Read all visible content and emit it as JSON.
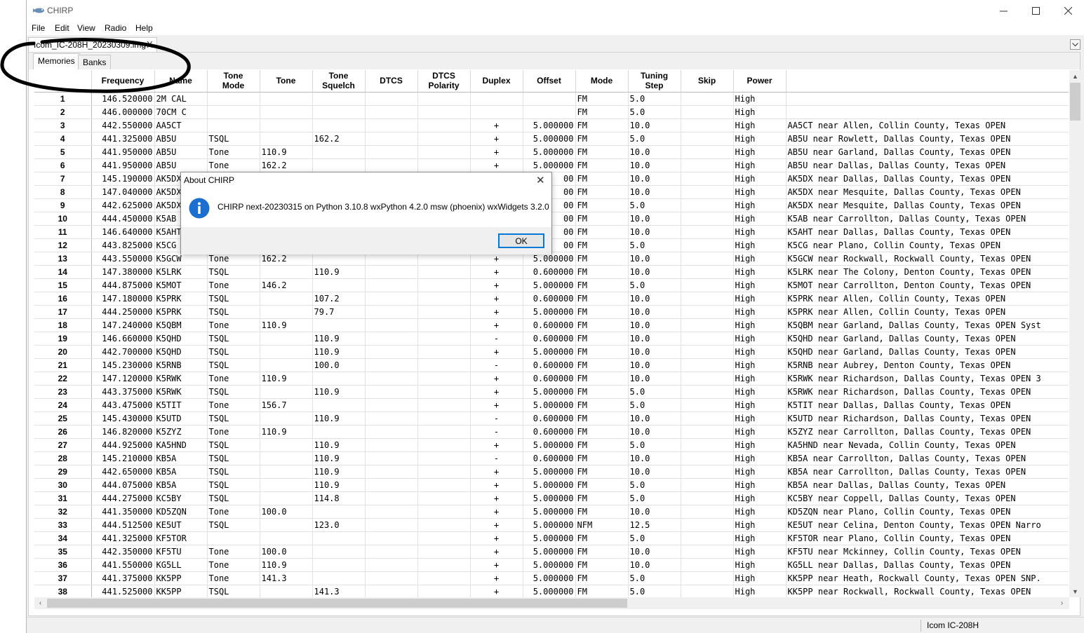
{
  "window": {
    "title": "CHIRP"
  },
  "menu": [
    "File",
    "Edit",
    "View",
    "Radio",
    "Help"
  ],
  "file_tab": {
    "label": "Icom_IC-208H_20230309.img",
    "close_glyph": "X"
  },
  "subtabs": [
    "Memories",
    "Banks"
  ],
  "columns": [
    "",
    "Frequency",
    "Name",
    "Tone\nMode",
    "Tone",
    "Tone\nSquelch",
    "DTCS",
    "DTCS\nPolarity",
    "Duplex",
    "Offset",
    "Mode",
    "Tuning\nStep",
    "Skip",
    "Power",
    ""
  ],
  "rows": [
    [
      "1",
      "146.520000",
      "2M CAL",
      "",
      "",
      "",
      "",
      "",
      "",
      "",
      "FM",
      "5.0",
      "",
      "High",
      ""
    ],
    [
      "2",
      "446.000000",
      "70CM C",
      "",
      "",
      "",
      "",
      "",
      "",
      "",
      "FM",
      "5.0",
      "",
      "High",
      ""
    ],
    [
      "3",
      "442.550000",
      "AA5CT",
      "",
      "",
      "",
      "",
      "",
      "+",
      "5.000000",
      "FM",
      "10.0",
      "",
      "High",
      "AA5CT near Allen, Collin County, Texas OPEN"
    ],
    [
      "4",
      "441.325000",
      "AB5U",
      "TSQL",
      "",
      "162.2",
      "",
      "",
      "+",
      "5.000000",
      "FM",
      "5.0",
      "",
      "High",
      "AB5U near Rowlett, Dallas County, Texas OPEN"
    ],
    [
      "5",
      "441.950000",
      "AB5U",
      "Tone",
      "110.9",
      "",
      "",
      "",
      "+",
      "5.000000",
      "FM",
      "10.0",
      "",
      "High",
      "AB5U near Garland, Dallas County, Texas OPEN"
    ],
    [
      "6",
      "441.950000",
      "AB5U",
      "Tone",
      "162.2",
      "",
      "",
      "",
      "+",
      "5.000000",
      "FM",
      "10.0",
      "",
      "High",
      "AB5U near Dallas, Dallas County, Texas OPEN"
    ],
    [
      "7",
      "145.190000",
      "AK5DX",
      "",
      "",
      "",
      "",
      "",
      "",
      "00",
      "FM",
      "10.0",
      "",
      "High",
      "AK5DX near Dallas, Dallas County, Texas OPEN"
    ],
    [
      "8",
      "147.040000",
      "AK5DX",
      "",
      "",
      "",
      "",
      "",
      "",
      "00",
      "FM",
      "10.0",
      "",
      "High",
      "AK5DX near Mesquite, Dallas County, Texas OPEN"
    ],
    [
      "9",
      "442.625000",
      "AK5DX",
      "",
      "",
      "",
      "",
      "",
      "",
      "00",
      "FM",
      "5.0",
      "",
      "High",
      "AK5DX near Mesquite, Dallas County, Texas OPEN"
    ],
    [
      "10",
      "444.450000",
      "K5AB",
      "",
      "",
      "",
      "",
      "",
      "",
      "00",
      "FM",
      "10.0",
      "",
      "High",
      "K5AB near Carrollton, Dallas County, Texas OPEN"
    ],
    [
      "11",
      "146.640000",
      "K5AHT",
      "",
      "",
      "",
      "",
      "",
      "",
      "00",
      "FM",
      "10.0",
      "",
      "High",
      "K5AHT near Dallas, Dallas County, Texas OPEN"
    ],
    [
      "12",
      "443.825000",
      "K5CG",
      "",
      "",
      "",
      "",
      "",
      "",
      "00",
      "FM",
      "5.0",
      "",
      "High",
      "K5CG near Plano, Collin County, Texas OPEN"
    ],
    [
      "13",
      "443.550000",
      "K5GCW",
      "Tone",
      "162.2",
      "",
      "",
      "",
      "+",
      "5.000000",
      "FM",
      "10.0",
      "",
      "High",
      "K5GCW near Rockwall, Rockwall County, Texas OPEN"
    ],
    [
      "14",
      "147.380000",
      "K5LRK",
      "TSQL",
      "",
      "110.9",
      "",
      "",
      "+",
      "0.600000",
      "FM",
      "10.0",
      "",
      "High",
      "K5LRK near The Colony, Denton County, Texas OPEN"
    ],
    [
      "15",
      "444.875000",
      "K5MOT",
      "Tone",
      "146.2",
      "",
      "",
      "",
      "+",
      "5.000000",
      "FM",
      "5.0",
      "",
      "High",
      "K5MOT near Carrollton, Denton County, Texas OPEN"
    ],
    [
      "16",
      "147.180000",
      "K5PRK",
      "TSQL",
      "",
      "107.2",
      "",
      "",
      "+",
      "0.600000",
      "FM",
      "10.0",
      "",
      "High",
      "K5PRK near Allen, Collin County, Texas OPEN"
    ],
    [
      "17",
      "444.250000",
      "K5PRK",
      "TSQL",
      "",
      "79.7",
      "",
      "",
      "+",
      "5.000000",
      "FM",
      "10.0",
      "",
      "High",
      "K5PRK near Allen, Collin County, Texas OPEN"
    ],
    [
      "18",
      "147.240000",
      "K5QBM",
      "Tone",
      "110.9",
      "",
      "",
      "",
      "+",
      "0.600000",
      "FM",
      "10.0",
      "",
      "High",
      "K5QBM near Garland, Dallas County, Texas OPEN Syst"
    ],
    [
      "19",
      "146.660000",
      "K5QHD",
      "TSQL",
      "",
      "110.9",
      "",
      "",
      "-",
      "0.600000",
      "FM",
      "10.0",
      "",
      "High",
      "K5QHD near Garland, Dallas County, Texas OPEN"
    ],
    [
      "20",
      "442.700000",
      "K5QHD",
      "TSQL",
      "",
      "110.9",
      "",
      "",
      "+",
      "5.000000",
      "FM",
      "10.0",
      "",
      "High",
      "K5QHD near Garland, Dallas County, Texas OPEN"
    ],
    [
      "21",
      "145.230000",
      "K5RNB",
      "TSQL",
      "",
      "100.0",
      "",
      "",
      "-",
      "0.600000",
      "FM",
      "10.0",
      "",
      "High",
      "K5RNB near Aubrey, Denton County, Texas OPEN"
    ],
    [
      "22",
      "147.120000",
      "K5RWK",
      "Tone",
      "110.9",
      "",
      "",
      "",
      "+",
      "0.600000",
      "FM",
      "10.0",
      "",
      "High",
      "K5RWK near Richardson, Dallas County, Texas OPEN 3"
    ],
    [
      "23",
      "443.375000",
      "K5RWK",
      "TSQL",
      "",
      "110.9",
      "",
      "",
      "+",
      "5.000000",
      "FM",
      "5.0",
      "",
      "High",
      "K5RWK near Richardson, Dallas County, Texas OPEN"
    ],
    [
      "24",
      "443.475000",
      "K5TIT",
      "Tone",
      "156.7",
      "",
      "",
      "",
      "+",
      "5.000000",
      "FM",
      "5.0",
      "",
      "High",
      "K5TIT near Dallas, Dallas County, Texas OPEN"
    ],
    [
      "25",
      "145.430000",
      "K5UTD",
      "TSQL",
      "",
      "110.9",
      "",
      "",
      "-",
      "0.600000",
      "FM",
      "10.0",
      "",
      "High",
      "K5UTD near Richardson, Dallas County, Texas OPEN"
    ],
    [
      "26",
      "146.820000",
      "K5ZYZ",
      "Tone",
      "110.9",
      "",
      "",
      "",
      "-",
      "0.600000",
      "FM",
      "10.0",
      "",
      "High",
      "K5ZYZ near Carrollton, Dallas County, Texas OPEN"
    ],
    [
      "27",
      "444.925000",
      "KA5HND",
      "TSQL",
      "",
      "110.9",
      "",
      "",
      "+",
      "5.000000",
      "FM",
      "5.0",
      "",
      "High",
      "KA5HND near Nevada, Collin County, Texas OPEN"
    ],
    [
      "28",
      "145.210000",
      "KB5A",
      "TSQL",
      "",
      "110.9",
      "",
      "",
      "-",
      "0.600000",
      "FM",
      "10.0",
      "",
      "High",
      "KB5A near Carrollton, Dallas County, Texas OPEN"
    ],
    [
      "29",
      "442.650000",
      "KB5A",
      "TSQL",
      "",
      "110.9",
      "",
      "",
      "+",
      "5.000000",
      "FM",
      "10.0",
      "",
      "High",
      "KB5A near Carrollton, Dallas County, Texas OPEN"
    ],
    [
      "30",
      "444.075000",
      "KB5A",
      "TSQL",
      "",
      "110.9",
      "",
      "",
      "+",
      "5.000000",
      "FM",
      "5.0",
      "",
      "High",
      "KB5A near Dallas, Dallas County, Texas OPEN"
    ],
    [
      "31",
      "444.275000",
      "KC5BY",
      "TSQL",
      "",
      "114.8",
      "",
      "",
      "+",
      "5.000000",
      "FM",
      "5.0",
      "",
      "High",
      "KC5BY near Coppell, Dallas County, Texas OPEN"
    ],
    [
      "32",
      "441.350000",
      "KD5ZQN",
      "Tone",
      "100.0",
      "",
      "",
      "",
      "+",
      "5.000000",
      "FM",
      "10.0",
      "",
      "High",
      "KD5ZQN near Plano, Collin County, Texas OPEN"
    ],
    [
      "33",
      "444.512500",
      "KE5UT",
      "TSQL",
      "",
      "123.0",
      "",
      "",
      "+",
      "5.000000",
      "NFM",
      "12.5",
      "",
      "High",
      "KE5UT near Celina, Denton County, Texas OPEN Narro"
    ],
    [
      "34",
      "441.325000",
      "KF5TOR",
      "",
      "",
      "",
      "",
      "",
      "+",
      "5.000000",
      "FM",
      "5.0",
      "",
      "High",
      "KF5TOR near Plano, Collin County, Texas OPEN"
    ],
    [
      "35",
      "442.350000",
      "KF5TU",
      "Tone",
      "100.0",
      "",
      "",
      "",
      "+",
      "5.000000",
      "FM",
      "10.0",
      "",
      "High",
      "KF5TU near Mckinney, Collin County, Texas OPEN"
    ],
    [
      "36",
      "441.550000",
      "KG5LL",
      "Tone",
      "110.9",
      "",
      "",
      "",
      "+",
      "5.000000",
      "FM",
      "10.0",
      "",
      "High",
      "KG5LL near Dallas, Dallas County, Texas OPEN"
    ],
    [
      "37",
      "441.375000",
      "KK5PP",
      "Tone",
      "141.3",
      "",
      "",
      "",
      "+",
      "5.000000",
      "FM",
      "5.0",
      "",
      "High",
      "KK5PP near Heath, Rockwall County, Texas OPEN SNP."
    ],
    [
      "38",
      "441.525000",
      "KK5PP",
      "TSQL",
      "",
      "141.3",
      "",
      "",
      "+",
      "5.000000",
      "FM",
      "5.0",
      "",
      "High",
      "KK5PP near Rockwall, Rockwall County, Texas OPEN"
    ]
  ],
  "status": {
    "radio": "Icom IC-208H"
  },
  "dialog": {
    "title": "About CHIRP",
    "message": "CHIRP next-20230315 on Python 3.10.8 wxPython 4.2.0 msw (phoenix) wxWidgets 3.2.0",
    "ok_label": "OK",
    "icon": "info-icon"
  },
  "colors": {
    "accent": "#0078d7",
    "annotation": "#000000"
  }
}
